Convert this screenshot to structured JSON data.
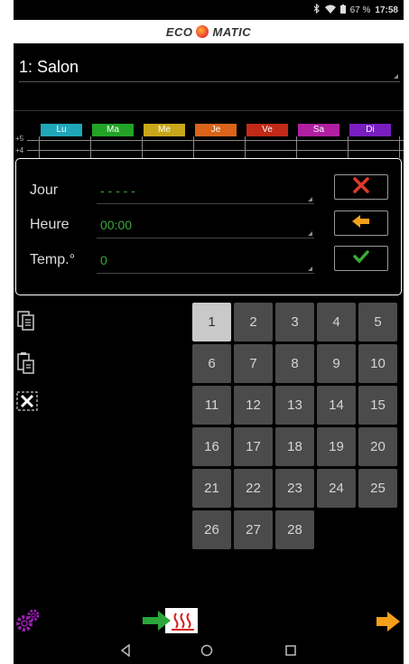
{
  "status_bar": {
    "battery_text": "67 %",
    "time": "17:58"
  },
  "brand": {
    "left_text": "ECO",
    "right_text": "MATIC"
  },
  "room_selector": {
    "value": "1: Salon"
  },
  "week_days": [
    {
      "label": "Lu",
      "color": "#1fa7b8"
    },
    {
      "label": "Ma",
      "color": "#22a327"
    },
    {
      "label": "Me",
      "color": "#c9a71a"
    },
    {
      "label": "Je",
      "color": "#d9641a"
    },
    {
      "label": "Ve",
      "color": "#c02a17"
    },
    {
      "label": "Sa",
      "color": "#b11fa0"
    },
    {
      "label": "Di",
      "color": "#7a1ec0"
    }
  ],
  "scale": {
    "top_label": "+5",
    "bottom_label": "+4"
  },
  "editor": {
    "fields": [
      {
        "label": "Jour",
        "value": "- - - - -"
      },
      {
        "label": "Heure",
        "value": "00:00"
      },
      {
        "label": "Temp.°",
        "value": "0"
      }
    ]
  },
  "calendar": {
    "days": [
      "1",
      "2",
      "3",
      "4",
      "5",
      "6",
      "7",
      "8",
      "9",
      "10",
      "11",
      "12",
      "13",
      "14",
      "15",
      "16",
      "17",
      "18",
      "19",
      "20",
      "21",
      "22",
      "23",
      "24",
      "25",
      "26",
      "27",
      "28"
    ],
    "selected": "1"
  },
  "colors": {
    "accent_green": "#39a935",
    "cancel_red": "#e03a2a",
    "back_orange": "#f5a01a",
    "settings_purple": "#9b1fb5"
  }
}
